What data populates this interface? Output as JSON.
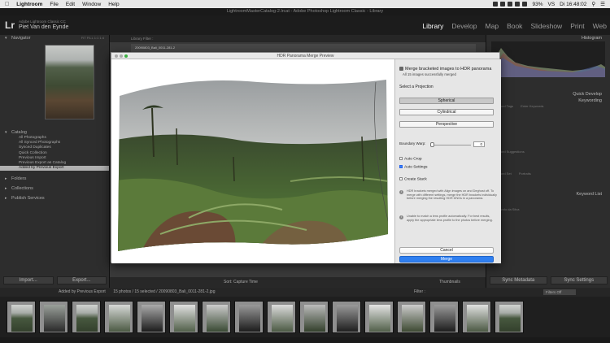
{
  "menubar": {
    "app": "Lightroom",
    "items": [
      "File",
      "Edit",
      "Window",
      "Help"
    ],
    "battery": "93%",
    "input_source": "VS",
    "clock": "Di 16:48:02"
  },
  "window_title": "LightroomMasterCatalog-2.lrcat - Adobe Photoshop Lightroom Classic - Library",
  "identity": {
    "catalog_label": "Adobe Lightroom Classic CC",
    "user": "Piet Van den Eynde",
    "modules": [
      "Library",
      "Develop",
      "Map",
      "Book",
      "Slideshow",
      "Print",
      "Web"
    ],
    "active_module": "Library"
  },
  "left_panel": {
    "navigator": "Navigator",
    "navigator_zoom": "FIT   FILL   1:1   1:4",
    "catalog": "Catalog",
    "catalog_items": [
      "All Photographs",
      "All Synced Photographs",
      "Synced Duplicates",
      "Quick Collection",
      "Previous Import",
      "Previous Export as Catalog",
      "Added by Previous Export"
    ],
    "folders": "Folders",
    "collections": "Collections",
    "publish_services": "Publish Services",
    "import_btn": "Import...",
    "export_btn": "Export..."
  },
  "center": {
    "library_filter": "Library Filter :",
    "grid_filename": "20090803_Bali_0011-281-2",
    "toolbar_sort": "Sort:",
    "toolbar_sort_value": "Capture Time",
    "thumbnails": "Thumbnails"
  },
  "right_panel": {
    "histogram": "Histogram",
    "quick_develop": "Quick Develop",
    "keywording": "Keywording",
    "keyword_tags": "Keyword Tags",
    "keyword_tags_value": "Enter Keywords",
    "keyword_suggestions": "Keyword Suggestions",
    "keyword_set": "Keyword Set",
    "keyword_set_value": "Portraits",
    "keyword_list": "Keyword List",
    "keyword_entry_1": "Fernando da Silva",
    "sync_metadata": "Sync Metadata",
    "sync_settings": "Sync Settings"
  },
  "filmbar": {
    "source": "Added by Previous Export",
    "count": "15 photos / 15 selected / 20090803_Bali_0011-281-2.jpg",
    "filter_label": "Filter :",
    "filters_off": "Filters Off"
  },
  "dialog": {
    "title": "HDR Panorama Merge Preview",
    "status_title": "Merge bracketed images to HDR panorama",
    "status_sub": "All 15 images successfully merged",
    "projection_label": "Select a Projection",
    "projections": [
      "Spherical",
      "Cylindrical",
      "Perspective"
    ],
    "selected_projection": "Spherical",
    "boundary_warp_label": "Boundary Warp:",
    "boundary_warp_value": "0",
    "boundary_warp_level": 0,
    "auto_crop": "Auto Crop",
    "auto_crop_checked": false,
    "auto_settings": "Auto Settings",
    "auto_settings_checked": true,
    "create_stack": "Create Stack",
    "create_stack_checked": false,
    "info_1": "HDR brackets merged with Align images on and Deghost off. To merge with different settings, merge the HDR brackets individually before merging the resulting HDR DNGs in a panorama.",
    "info_2": "Unable to match a lens profile automatically. For best results, apply the appropriate lens profile to the photos before merging.",
    "cancel": "Cancel",
    "merge": "Merge"
  }
}
